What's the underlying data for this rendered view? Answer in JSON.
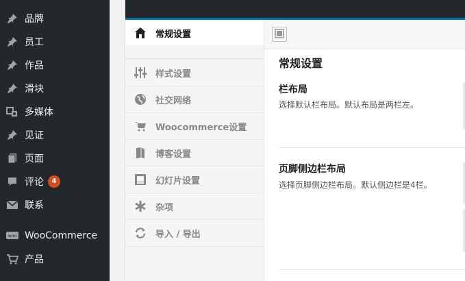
{
  "wp_menu": {
    "items": [
      {
        "label": "品牌",
        "icon": "pin-icon"
      },
      {
        "label": "员工",
        "icon": "pin-icon"
      },
      {
        "label": "作品",
        "icon": "pin-icon"
      },
      {
        "label": "滑块",
        "icon": "pin-icon"
      },
      {
        "label": "多媒体",
        "icon": "media-icon"
      },
      {
        "label": "见证",
        "icon": "pin-icon"
      },
      {
        "label": "页面",
        "icon": "pages-icon"
      },
      {
        "label": "评论",
        "icon": "comment-icon",
        "badge": "4"
      },
      {
        "label": "联系",
        "icon": "mail-icon"
      },
      {
        "label": "WooCommerce",
        "icon": "woo-icon"
      },
      {
        "label": "产品",
        "icon": "cart-icon"
      }
    ]
  },
  "options_nav": {
    "items": [
      {
        "label": "常规设置",
        "icon": "home-icon",
        "active": true
      },
      {
        "label": "样式设置",
        "icon": "sliders-icon"
      },
      {
        "label": "社交网络",
        "icon": "globe-icon"
      },
      {
        "label": "Woocommerce设置",
        "icon": "cart-icon"
      },
      {
        "label": "博客设置",
        "icon": "book-icon"
      },
      {
        "label": "幻灯片设置",
        "icon": "slideshow-icon"
      },
      {
        "label": "杂项",
        "icon": "asterisk-icon"
      },
      {
        "label": "导入 / 导出",
        "icon": "refresh-icon"
      }
    ]
  },
  "content": {
    "section_title": "常规设置",
    "fields": [
      {
        "title": "栏布局",
        "desc": "选择默认栏布局。默认布局是两栏左。"
      },
      {
        "title": "页脚侧边栏布局",
        "desc": "选择页脚侧边栏布局。默认侧边栏是4栏。"
      }
    ]
  },
  "colors": {
    "sidebar_bg": "#23282d",
    "accent": "#0073aa",
    "badge": "#d54e21"
  }
}
